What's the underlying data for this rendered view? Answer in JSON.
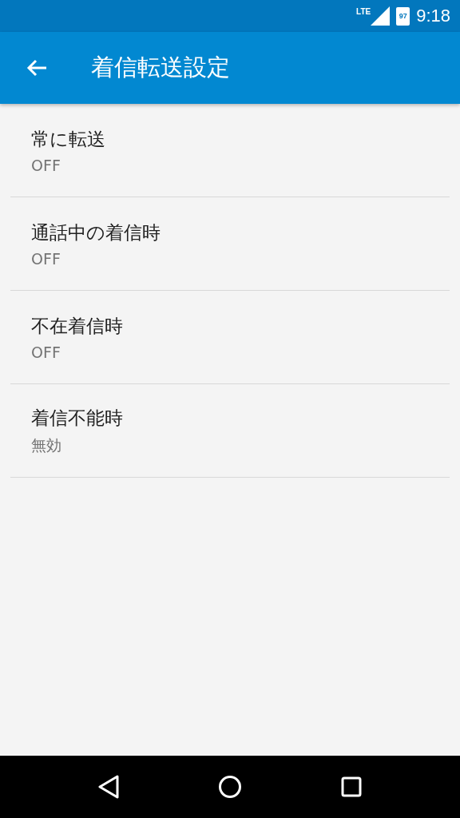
{
  "status_bar": {
    "network": "LTE",
    "battery": "97",
    "time": "9:18"
  },
  "app_bar": {
    "title": "着信転送設定"
  },
  "settings": [
    {
      "title": "常に転送",
      "summary": "OFF"
    },
    {
      "title": "通話中の着信時",
      "summary": "OFF"
    },
    {
      "title": "不在着信時",
      "summary": "OFF"
    },
    {
      "title": "着信不能時",
      "summary": "無効"
    }
  ]
}
